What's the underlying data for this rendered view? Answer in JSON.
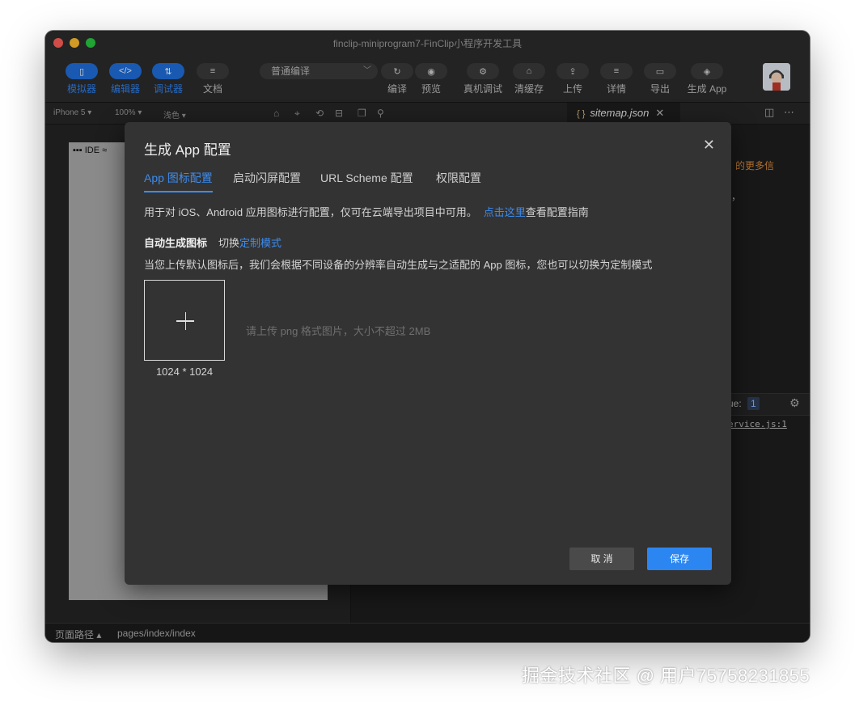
{
  "window": {
    "title": "finclip-miniprogram7-FinClip小程序开发工具"
  },
  "toolbar": {
    "left_buttons": [
      {
        "label": "模拟器",
        "icon": "phone-icon",
        "glyph": "▯"
      },
      {
        "label": "编辑器",
        "icon": "code-icon",
        "glyph": "</>"
      },
      {
        "label": "调试器",
        "icon": "debug-icon",
        "glyph": "⇅"
      },
      {
        "label": "文档",
        "icon": "document-icon",
        "glyph": "≡"
      }
    ],
    "compile_mode": "普通编译",
    "right_buttons": [
      {
        "label": "编译",
        "icon": "refresh-icon",
        "glyph": "↻"
      },
      {
        "label": "预览",
        "icon": "eye-icon",
        "glyph": "◉"
      },
      {
        "label": "真机调试",
        "icon": "bug-icon",
        "glyph": "⚙"
      },
      {
        "label": "清缓存",
        "icon": "clear-cache-icon",
        "glyph": "⌂"
      },
      {
        "label": "上传",
        "icon": "upload-icon",
        "glyph": "⇪"
      },
      {
        "label": "详情",
        "icon": "details-icon",
        "glyph": "≡"
      },
      {
        "label": "导出",
        "icon": "folder-icon",
        "glyph": "▭"
      },
      {
        "label": "生成 App",
        "icon": "cube-icon",
        "glyph": "◈"
      }
    ]
  },
  "subbar": {
    "device": "iPhone 5 ▾",
    "zoom": "100% ▾",
    "theme": "浅色 ▾",
    "editor_tab": "sitemap.json",
    "editor_tab_brace": "{ }"
  },
  "simulator": {
    "status": "▪▪▪ IDE ≈"
  },
  "editor": {
    "snippet_text": "的更多信",
    "comma": "，",
    "console_issue": "ue:",
    "console_count": "1",
    "console_link": "ervice.js:1"
  },
  "statusbar": {
    "label": "页面路径 ▴",
    "path": "pages/index/index"
  },
  "dialog": {
    "title": "生成 App 配置",
    "tabs": [
      "App 图标配置",
      "启动闪屏配置",
      "URL Scheme 配置",
      "权限配置"
    ],
    "active_tab": "App 图标配置",
    "description": "用于对 iOS、Android 应用图标进行配置，仅可在云端导出项目中可用。",
    "description_link": "点击这里",
    "description_suffix": "查看配置指南",
    "section_title": "自动生成图标",
    "switch_prefix": "切换",
    "switch_link": "定制模式",
    "section_desc": "当您上传默认图标后，我们会根据不同设备的分辨率自动生成与之适配的 App 图标，您也可以切换为定制模式",
    "icon_size": "1024 * 1024",
    "upload_hint": "请上传 png 格式图片，大小不超过 2MB",
    "cancel_label": "取 消",
    "save_label": "保存"
  },
  "watermark": "掘金技术社区 @ 用户75758231855",
  "colors": {
    "accent": "#2b86f2",
    "link": "#3c8cf0",
    "dialog_bg": "#333333",
    "window_bg": "#1e1e1e"
  }
}
